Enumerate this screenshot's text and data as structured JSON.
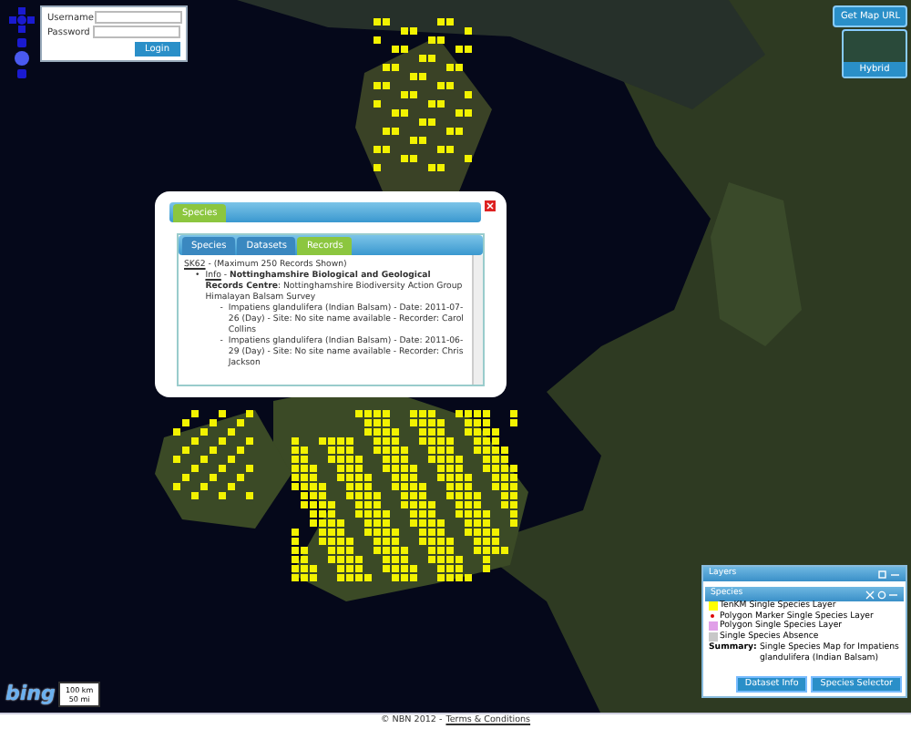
{
  "login": {
    "fields": [
      {
        "label": "Username"
      },
      {
        "label": "Password"
      }
    ],
    "button": "Login"
  },
  "map_controls": {
    "map_url_button": "Get Map URL",
    "map_type_button": "Hybrid"
  },
  "popup": {
    "tabs": [
      {
        "label": "Species",
        "selected": true
      }
    ],
    "inner_tabs": [
      {
        "label": "Species",
        "selected": false
      },
      {
        "label": "Datasets",
        "selected": false
      },
      {
        "label": "Records",
        "selected": true
      }
    ],
    "grid_ref": "SK62",
    "grid_note": "- (Maximum 250 Records Shown)",
    "dataset": {
      "marker": "•",
      "link": "Info",
      "text": "- **Nottinghamshire Biological and Geological Records Centre**: Nottinghamshire Biodiversity Action Group Himalayan Balsam Survey"
    },
    "records": [
      {
        "marker": "-",
        "text": "Impatiens glandulifera (Indian Balsam) - Date: 2011-07-26 (Day) - Site: No site name available - Recorder: Carol Collins"
      },
      {
        "marker": "-",
        "text": "Impatiens glandulifera (Indian Balsam) - Date: 2011-06-29 (Day) - Site: No site name available - Recorder: Chris Jackson"
      }
    ]
  },
  "layers_panel": {
    "title": "Layers",
    "section": "Species",
    "legend": [
      {
        "kind": "square",
        "color": "#ffff00",
        "label": "TenKM Single Species Layer"
      },
      {
        "kind": "dot",
        "color": "#dd0000",
        "label": "Polygon Marker Single Species Layer"
      },
      {
        "kind": "square",
        "color": "#e0a0e8",
        "label": "Polygon Single Species Layer"
      },
      {
        "kind": "square",
        "color": "#c8c8c8",
        "label": "Single Species Absence"
      }
    ],
    "summary_label": "Summary:",
    "summary": "Single Species Map for Impatiens glandulifera (Indian Balsam)",
    "buttons": [
      "Dataset Info",
      "Species Selector"
    ]
  },
  "map_footer": {
    "logo": "bing",
    "scale": [
      "100 km",
      "50 mi"
    ]
  },
  "footer": {
    "copyright": "© NBN 2012 -",
    "link": "Terms & Conditions"
  }
}
